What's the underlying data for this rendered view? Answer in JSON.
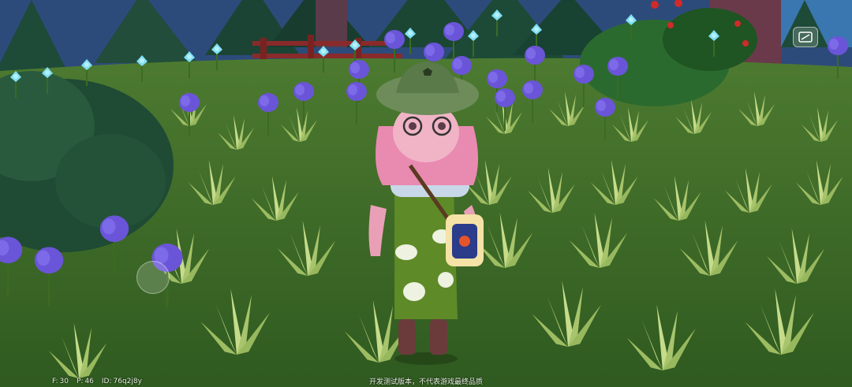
{
  "hud": {
    "fps_label": "F:",
    "fps_value": "30",
    "ping_label": "P:",
    "ping_value": "46",
    "id_label": "ID:",
    "id_value": "76q2j8y",
    "disclaimer": "开发测试版本，不代表游戏最终品质"
  },
  "icons": {
    "screen_toggle": "screen-mode-icon",
    "joystick": "virtual-joystick"
  },
  "colors": {
    "sky": "#2c4a78",
    "grass_dark": "#3f6b2a",
    "grass_light": "#a9c96e",
    "flower_purple": "#6b5ae0",
    "flower_cyan": "#6fd8f0",
    "hat": "#5c7a4a",
    "hair": "#e98ab0",
    "overalls": "#5d8a2a"
  }
}
